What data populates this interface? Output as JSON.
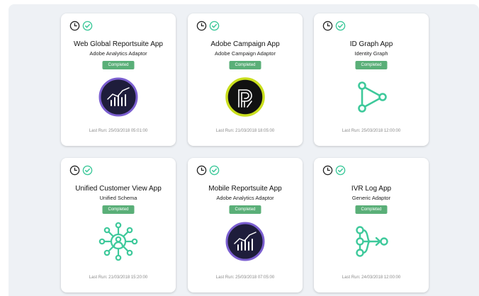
{
  "colors": {
    "panel": "#eef1f5",
    "badge": "#5aaf78",
    "accent": "#3ec99b",
    "purple": "#6b4fbb"
  },
  "icons": {
    "clock": "clock-icon",
    "check": "check-circle-icon"
  },
  "cards": [
    {
      "title": "Web Global Reportsuite App",
      "subtitle": "Adobe Analytics Adaptor",
      "status": "Completed",
      "last_run": "Last Run: 25/03/2018 05:01:00",
      "logo": "adobe-analytics-logo"
    },
    {
      "title": "Adobe Campaign App",
      "subtitle": "Adobe Campaign Adaptor",
      "status": "Completed",
      "last_run": "Last Run: 21/03/2018 18:05:00",
      "logo": "adobe-campaign-logo"
    },
    {
      "title": "ID Graph App",
      "subtitle": "Identity Graph",
      "status": "Completed",
      "last_run": "Last Run: 25/03/2018 12:00:00",
      "logo": "identity-graph-icon"
    },
    {
      "title": "Unified Customer View App",
      "subtitle": "Unified Schema",
      "status": "Completed",
      "last_run": "Last Run: 21/03/2018 15:20:00",
      "logo": "unified-schema-icon"
    },
    {
      "title": "Mobile Reportsuite App",
      "subtitle": "Adobe Analytics Adaptor",
      "status": "Completed",
      "last_run": "Last Run: 25/03/2018 07:05:00",
      "logo": "adobe-analytics-logo"
    },
    {
      "title": "IVR Log App",
      "subtitle": "Generic Adaptor",
      "status": "Completed",
      "last_run": "Last Run: 24/03/2018 12:00:00",
      "logo": "generic-adaptor-icon"
    }
  ]
}
